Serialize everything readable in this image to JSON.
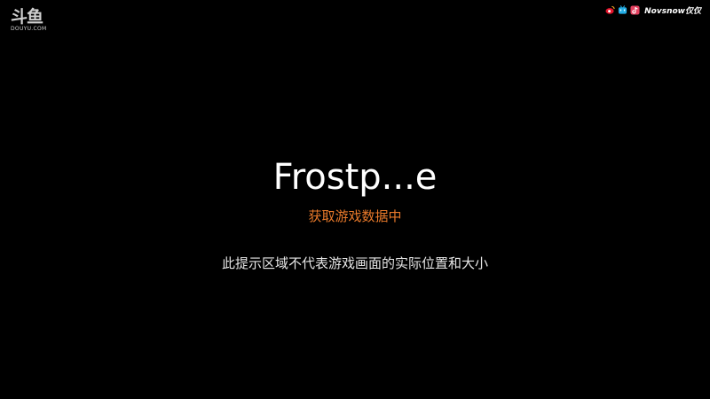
{
  "watermark": {
    "logo_mark": "斗鱼",
    "logo_sub": "DOUYU.COM",
    "icon": "douyu-logo-icon"
  },
  "social": {
    "icons": [
      "weibo-icon",
      "bilibili-icon",
      "douyin-icon"
    ],
    "handle": "Novsnow仅仅"
  },
  "main": {
    "title": "Frostp...e",
    "loading": "获取游戏数据中",
    "notice": "此提示区域不代表游戏画面的实际位置和大小"
  },
  "colors": {
    "background": "#000000",
    "title": "#ffffff",
    "loading": "#e8792a",
    "notice": "#e6e6e6"
  }
}
